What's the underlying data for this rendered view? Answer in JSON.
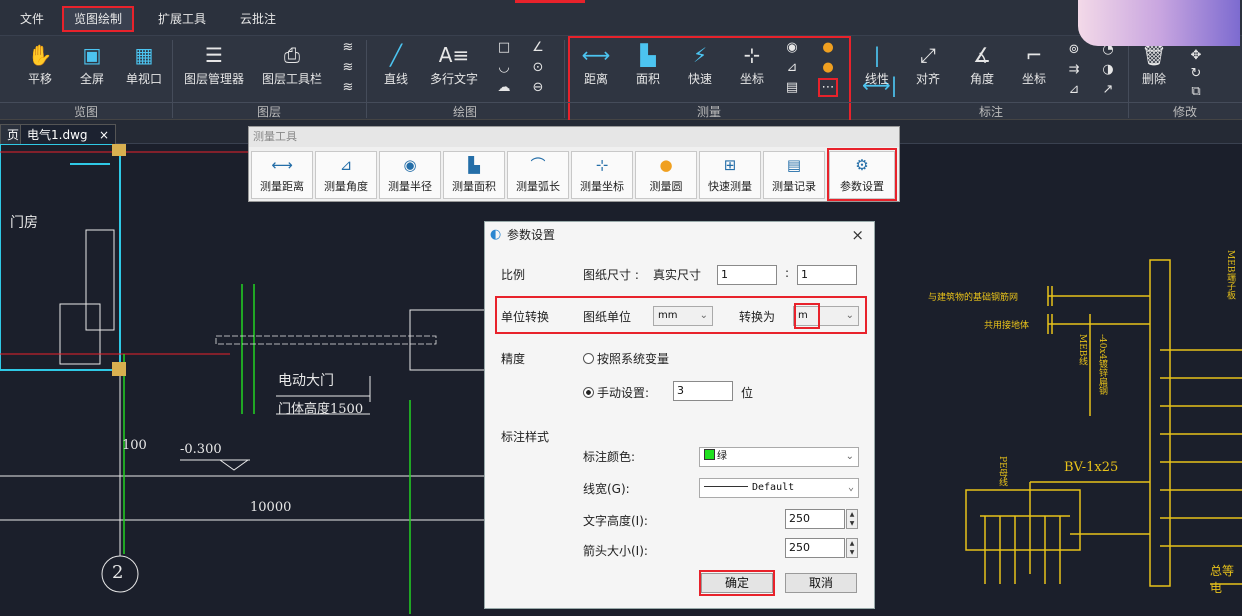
{
  "menu": {
    "file": "文件",
    "view_draw": "览图绘制",
    "extend": "扩展工具",
    "cloud": "云批注"
  },
  "ribbon": {
    "pan": "平移",
    "fullscreen": "全屏",
    "single_view": "单视口",
    "layer_manager": "图层管理器",
    "layer_toolbar": "图层工具栏",
    "line": "直线",
    "mtext": "多行文字",
    "distance": "距离",
    "area": "面积",
    "quick": "快速",
    "coordinate": "坐标",
    "linear": "线性",
    "align": "对齐",
    "angle": "角度",
    "coord_dim": "坐标",
    "delete": "删除",
    "groups": {
      "view": "览图",
      "layer": "图层",
      "draw": "绘图",
      "measure": "测量",
      "dimension": "标注",
      "modify": "修改"
    }
  },
  "tabbar": {
    "prefix": "页",
    "file_tab": "电气1.dwg",
    "close": "×"
  },
  "measure_toolbar": {
    "title": "测量工具",
    "buttons": [
      "测量距离",
      "测量角度",
      "测量半径",
      "测量面积",
      "测量弧长",
      "测量坐标",
      "测量圆",
      "快速测量",
      "测量记录",
      "参数设置"
    ]
  },
  "dialog": {
    "title": "参数设置",
    "close": "×",
    "scale_label": "比例",
    "paper_size": "图纸尺寸 :",
    "real_size": "真实尺寸",
    "paper_value": "1",
    "colon": ":",
    "real_value": "1",
    "unit_label": "单位转换",
    "paper_unit": "图纸单位",
    "paper_unit_value": "mm",
    "convert_to": "转换为",
    "convert_value": "m",
    "precision_label": "精度",
    "by_system": "按照系统变量",
    "manual": "手动设置:",
    "manual_value": "3",
    "digits": "位",
    "style_label": "标注样式",
    "color_label": "标注颜色:",
    "color_value": "绿",
    "linewidth_label": "线宽(G):",
    "linewidth_value": "Default",
    "text_height_label": "文字高度(I):",
    "text_height_value": "250",
    "arrow_label": "箭头大小(I):",
    "arrow_value": "250",
    "ok": "确定",
    "cancel": "取消"
  },
  "drawing": {
    "gate_room": "门房",
    "electric_gate": "电动大门",
    "gate_height": "门体高度1500",
    "dim_100": "100",
    "elev": "-0.300",
    "dim_10000": "10000",
    "axis_2": "2",
    "right_a": "与建筑物的基础钢筋网",
    "right_b": "共用接地体",
    "bv": "BV-1x25",
    "pe": "PE母线",
    "meb": "MEB线",
    "steel": "-40x4镀锌扁钢",
    "meb_box": "MEB端子板",
    "bottom_text": "总等电"
  },
  "colors": {
    "accent_red": "#e8222b",
    "cad_yellow": "#e8c21a",
    "cad_green": "#22d422",
    "cad_cyan": "#2fc9e6"
  }
}
